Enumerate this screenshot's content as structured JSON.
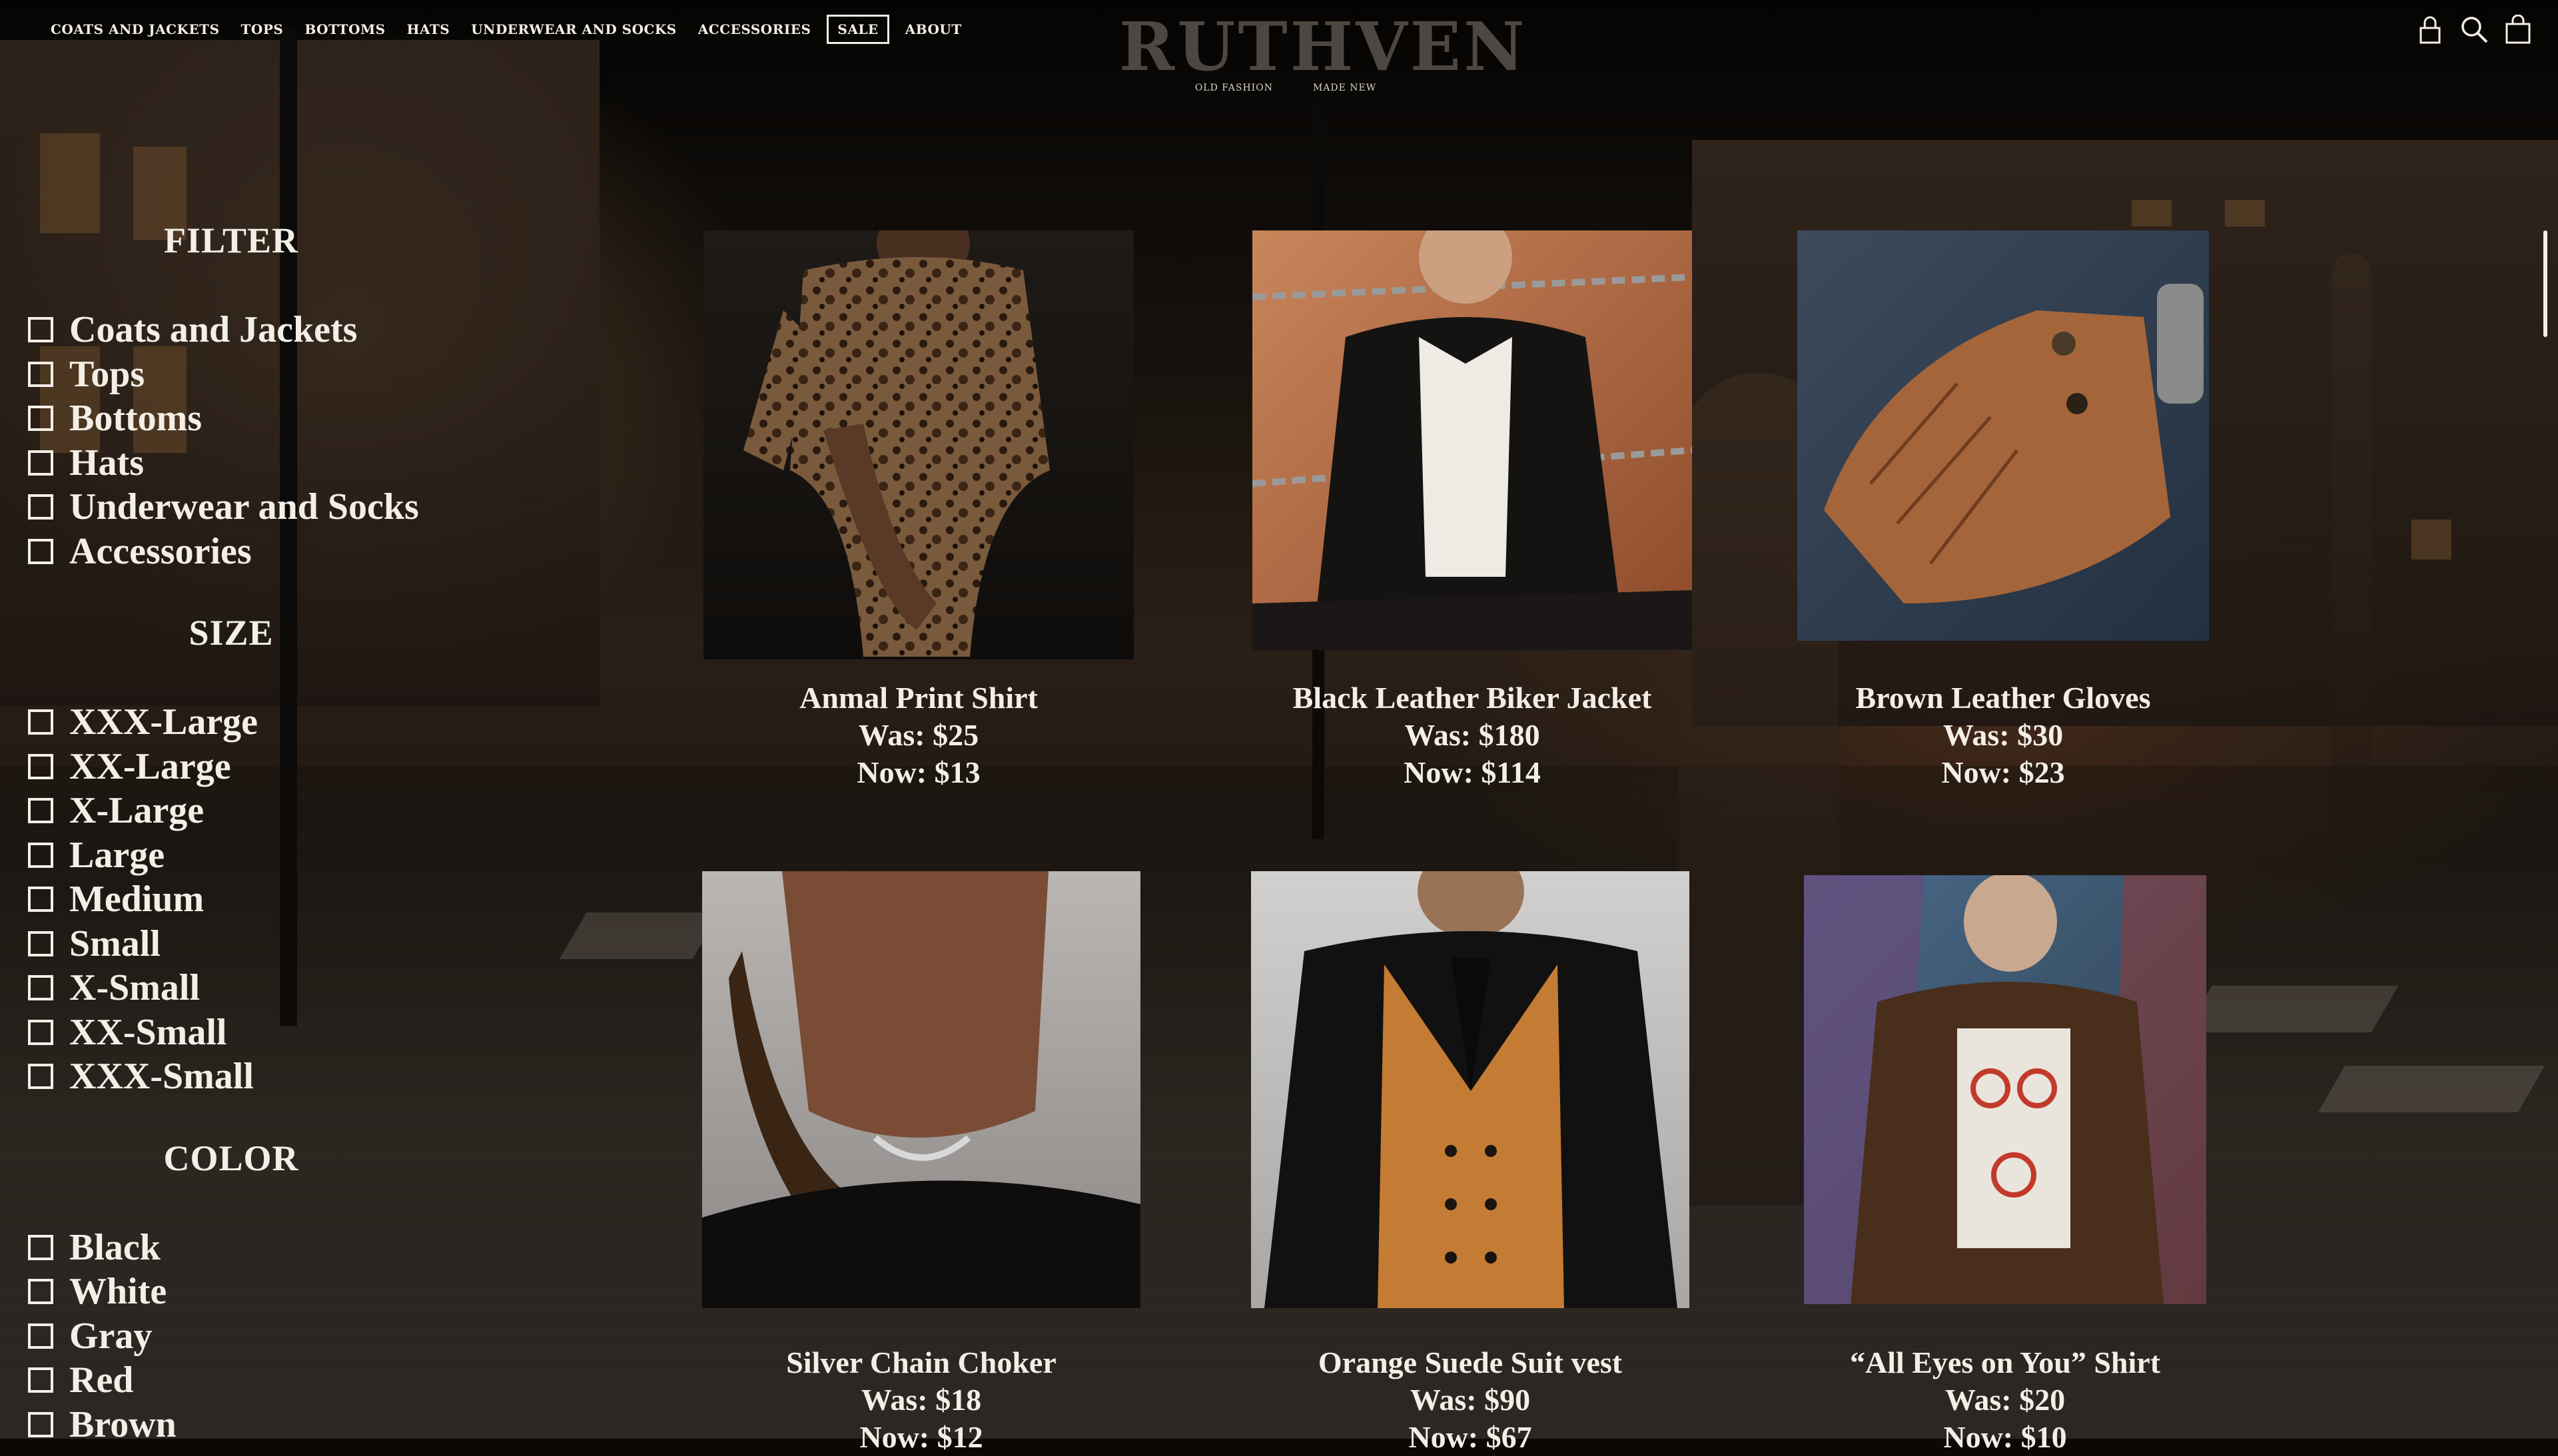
{
  "nav": {
    "items": [
      {
        "label": "COATS AND JACKETS"
      },
      {
        "label": "TOPS"
      },
      {
        "label": "BOTTOMS"
      },
      {
        "label": "HATS"
      },
      {
        "label": "UNDERWEAR AND SOCKS"
      },
      {
        "label": "ACCESSORIES"
      },
      {
        "label": "SALE",
        "active": true
      },
      {
        "label": "ABOUT"
      }
    ]
  },
  "brand": {
    "name": "RUTHVEN",
    "tagline_left": "OLD FASHION",
    "tagline_right": "MADE NEW"
  },
  "header_icons": [
    "lock-icon",
    "search-icon",
    "shopping-bag-icon"
  ],
  "sidebar": {
    "filter_title": "FILTER",
    "categories": [
      "Coats and Jackets",
      "Tops",
      "Bottoms",
      "Hats",
      "Underwear and Socks",
      "Accessories"
    ],
    "size_title": "SIZE",
    "sizes": [
      "XXX-Large",
      "XX-Large",
      "X-Large",
      "Large",
      "Medium",
      "Small",
      "X-Small",
      "XX-Small",
      "XXX-Small"
    ],
    "color_title": "COLOR",
    "colors": [
      "Black",
      "White",
      "Gray",
      "Red",
      "Brown"
    ]
  },
  "products": [
    {
      "name": "Anmal Print Shirt",
      "was": "Was: $25",
      "now": "Now: $13"
    },
    {
      "name": "Black Leather Biker Jacket",
      "was": "Was: $180",
      "now": "Now: $114"
    },
    {
      "name": "Brown Leather Gloves",
      "was": "Was: $30",
      "now": "Now: $23"
    },
    {
      "name": "Silver Chain Choker",
      "was": "Was: $18",
      "now": "Now: $12"
    },
    {
      "name": "Orange Suede Suit vest",
      "was": "Was: $90",
      "now": "Now: $67"
    },
    {
      "name": "“All Eyes on You” Shirt",
      "was": "Was: $20",
      "now": "Now: $10"
    }
  ],
  "colors": {
    "text": "#f4efe6",
    "background": "#0b0806",
    "logo": "#554e48"
  }
}
